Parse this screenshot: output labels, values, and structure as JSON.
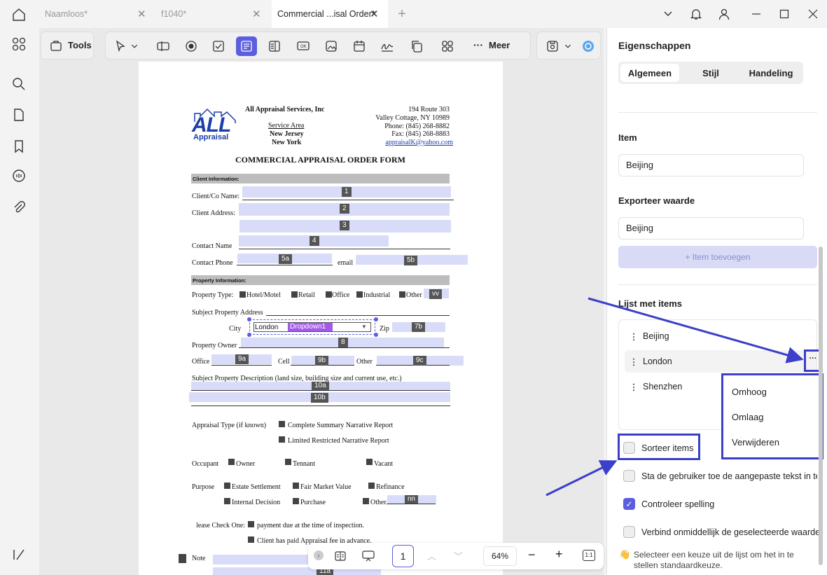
{
  "tabs": [
    {
      "label": "Naamloos*"
    },
    {
      "label": "f1040*"
    },
    {
      "label": "Commercial ...isal Order*"
    }
  ],
  "toolbar": {
    "tools_label": "Tools",
    "more_label": "Meer"
  },
  "pdf": {
    "company": "All Appraisal Services, Inc",
    "logo_big": "ALL",
    "logo_small": "Appraisal",
    "service_area_label": "Service Area",
    "service_area_1": "New Jersey",
    "service_area_2": "New York",
    "addr_1": "194 Route 303",
    "addr_2": "Valley Cottage, NY 10989",
    "phone": "Phone:  (845) 268-8882",
    "fax": "Fax:  (845) 268-8883",
    "email": "appraisalK@yahoo.com",
    "form_title": "COMMERCIAL APPRAISAL ORDER FORM",
    "client_info": "Client Information:",
    "client_name": "Client/Co Name:",
    "client_address": "Client Address:",
    "contact_name": "Contact Name",
    "contact_phone": "Contact Phone",
    "email_label": "email",
    "property_info": "Property Information:",
    "property_type": "Property Type:",
    "pt_hotel": "Hotel/Motel",
    "pt_retail": "Retail",
    "pt_office": "Office",
    "pt_industrial": "Industrial",
    "pt_other": "Other",
    "subject_address": "Subject Property Address",
    "city": "City",
    "city_value": "London",
    "dropdown_name": "Dropdown1",
    "zip": "Zip",
    "property_owner": "Property Owner",
    "office": "Office",
    "cell": "Cell",
    "other": "Other",
    "subject_desc": "Subject Property Description (land size, building size and current use, etc.)",
    "appraisal_type": "Appraisal Type (if known)",
    "at_complete": "Complete Summary Narrative Report",
    "at_limited": "Limited Restricted Narrative Report",
    "occupant": "Occupant",
    "oc_owner": "Owner",
    "oc_tennant": "Tennant",
    "oc_vacant": "Vacant",
    "purpose": "Purpose",
    "pu_estate": "Estate Settlement",
    "pu_fmv": "Fair Market Value",
    "pu_refinance": "Refinance",
    "pu_internal": "Internal Decision",
    "pu_purchase": "Purchase",
    "pu_other": "Other",
    "check_one": "lease Check One:",
    "payment": "payment due at the time of inspection.",
    "client_paid": "Client has paid Appraisal fee in advance.",
    "note": "Note",
    "field_numbers": [
      "1",
      "2",
      "3",
      "4",
      "5a",
      "5b",
      "vv",
      "7b",
      "8",
      "9a",
      "9b",
      "9c",
      "10a",
      "10b",
      "nn",
      "11a"
    ]
  },
  "bottom": {
    "page": "1",
    "zoom": "64%",
    "fit": "1:1"
  },
  "panel": {
    "title": "Eigenschappen",
    "tab_general": "Algemeen",
    "tab_style": "Stijl",
    "tab_action": "Handeling",
    "item_label": "Item",
    "item_value": "Beijing",
    "export_label": "Exporteer waarde",
    "export_value": "Beijing",
    "add_item": "+ Item toevoegen",
    "list_label": "Lijst met items",
    "items": [
      "Beijing",
      "London",
      "Shenzhen"
    ],
    "menu": [
      "Omhoog",
      "Omlaag",
      "Verwijderen"
    ],
    "sort": "Sorteer items",
    "allow_custom": "Sta de gebruiker toe de aangepaste tekst in te vo",
    "spellcheck": "Controleer spelling",
    "commit": "Verbind onmiddellijk de geselecteerde waarde",
    "hint": "Selecteer een keuze uit de lijst om het in te stellen standaardkeuze.",
    "hint_icon": "👋",
    "accent": "#3b3fc9"
  }
}
